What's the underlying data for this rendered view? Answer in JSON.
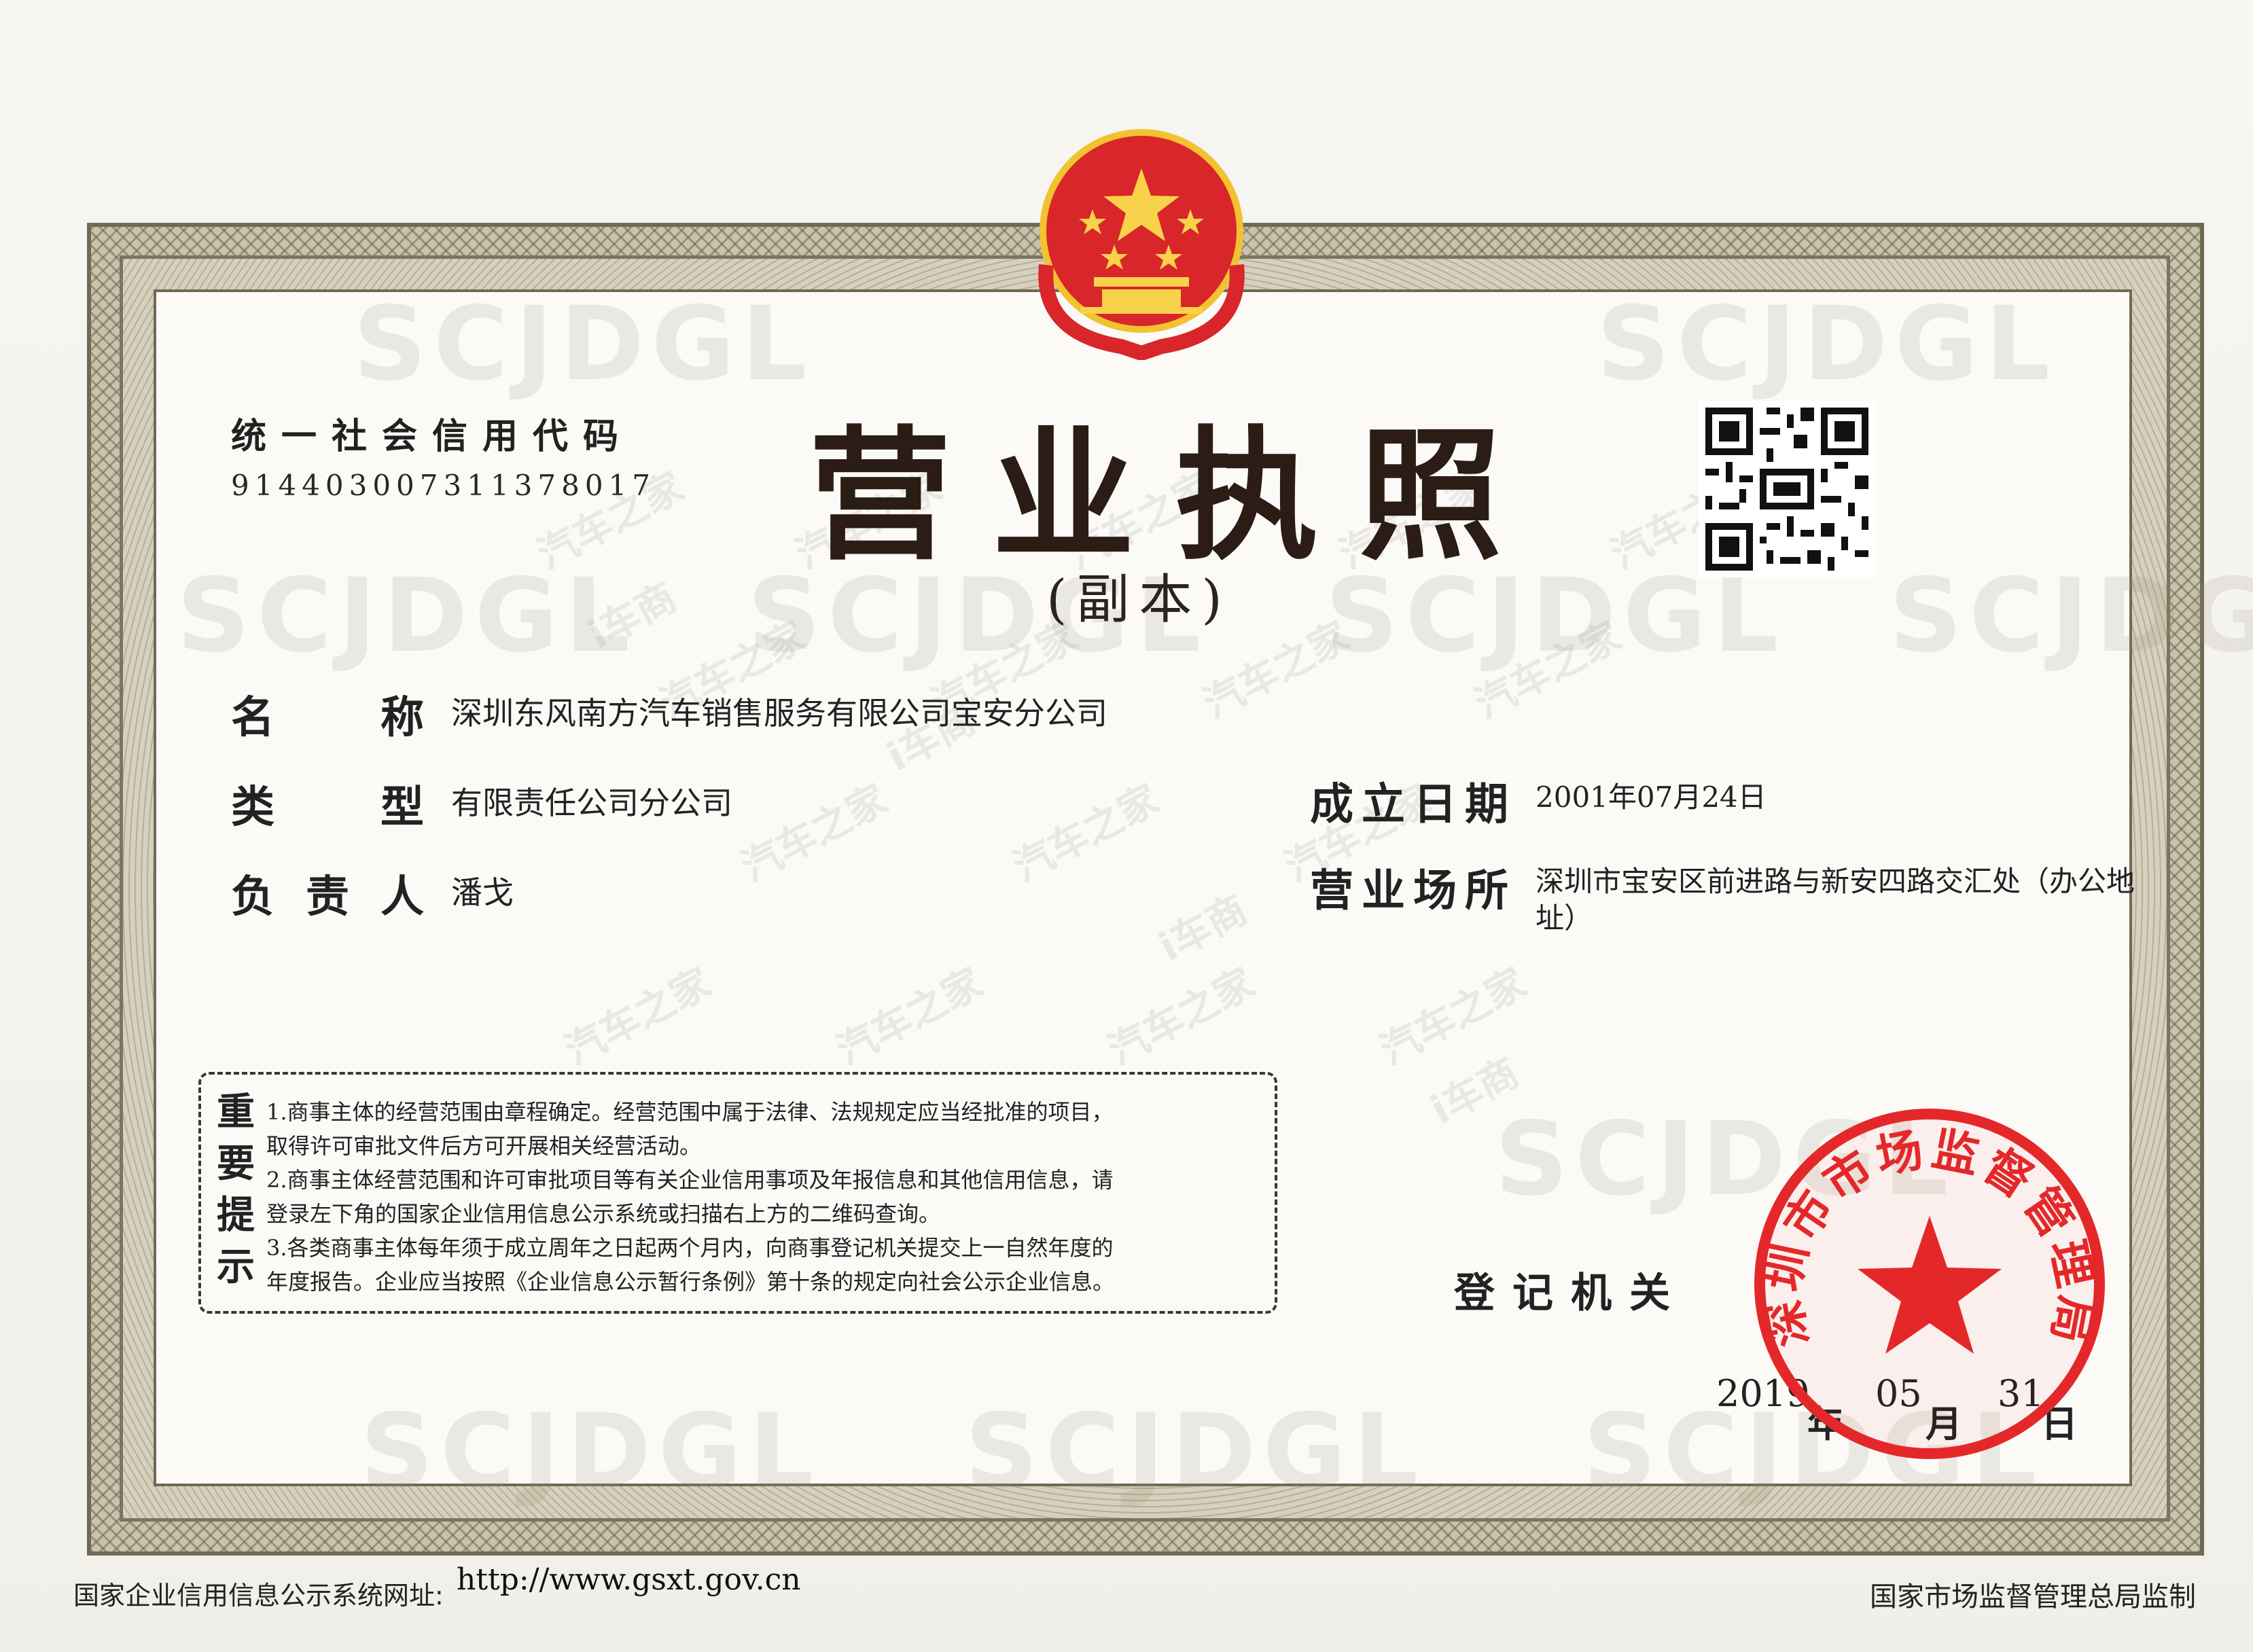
{
  "document": {
    "credit_label": "统一社会信用代码",
    "credit_code": "914403007311378017",
    "title": "营业执照",
    "subtitle": "(副本)"
  },
  "fields": {
    "name_label_1": "名",
    "name_label_2": "称",
    "name_value": "深圳东风南方汽车销售服务有限公司宝安分公司",
    "type_label_1": "类",
    "type_label_2": "型",
    "type_value": "有限责任公司分公司",
    "person_label_1": "负",
    "person_label_2": "责",
    "person_label_3": "人",
    "person_value": "潘戈",
    "established_label": "成立日期",
    "established_value": "2001年07月24日",
    "address_label": "营业场所",
    "address_line1": "深圳市宝安区前进路与新安四路交汇处（办公地",
    "address_line2": "址）"
  },
  "notice": {
    "title": [
      "重",
      "要",
      "提",
      "示"
    ],
    "lines": [
      "1.商事主体的经营范围由章程确定。经营范围中属于法律、法规规定应当经批准的项目，",
      "取得许可审批文件后方可开展相关经营活动。",
      "2.商事主体经营范围和许可审批项目等有关企业信用事项及年报信息和其他信用信息，请",
      "登录左下角的国家企业信用信息公示系统或扫描右上方的二维码查询。",
      "3.各类商事主体每年须于成立周年之日起两个月内，向商事登记机关提交上一自然年度的",
      "年度报告。企业应当按照《企业信息公示暂行条例》第十条的规定向社会公示企业信息。"
    ]
  },
  "registration": {
    "authority_label": "登记机关",
    "year": "2019",
    "year_unit": "年",
    "month": "05",
    "month_unit": "月",
    "day": "31",
    "day_unit": "日"
  },
  "seal": {
    "text": "深圳市市场监督管理局"
  },
  "watermarks": {
    "big": "SCJDGL",
    "small_a": "汽车之家",
    "small_b": "i车商"
  },
  "footer": {
    "left": "国家企业信用信息公示系统网址:",
    "url": "http://www.gsxt.gov.cn",
    "right": "国家市场监督管理总局监制"
  },
  "colors": {
    "seal_red": "#e4282a",
    "emblem_red": "#d8262a",
    "emblem_gold": "#f2c230",
    "frame": "#6f6a55"
  }
}
